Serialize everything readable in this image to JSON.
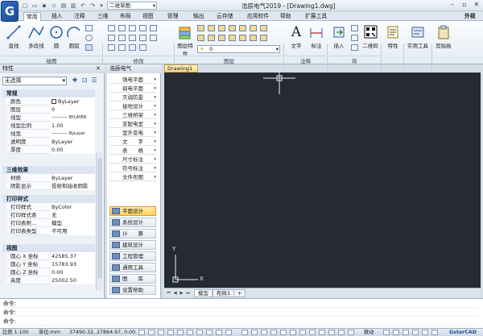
{
  "titlebar": {
    "logo_letter": "G",
    "workspace": "二维草图",
    "title": "浩辰电气2019 - [Drawing1.dwg]",
    "external": "外视"
  },
  "menu": {
    "tabs": [
      "常用",
      "插入",
      "注释",
      "三维",
      "布局",
      "视图",
      "管理",
      "输出",
      "云存储",
      "应用软件",
      "帮助",
      "扩展工具"
    ],
    "active": "常用"
  },
  "ribbon": {
    "tools": {
      "line": "直线",
      "polyline": "多段线",
      "circle": "圆",
      "arc": "圆弧",
      "layer_props": "图层特性",
      "text": "文字",
      "dimension": "标注",
      "insert": "插入",
      "qrcode": "二维码",
      "properties": "特性",
      "utilities": "实用工具",
      "clipboard": "剪贴板"
    },
    "layer_value": "0",
    "groups": [
      "绘图",
      "修改",
      "图层",
      "注释",
      "块"
    ]
  },
  "properties": {
    "title": "特性",
    "selection": "无选择",
    "sections": {
      "general": "常规",
      "effect3d": "三维效果",
      "plot": "打印样式",
      "view": "视图"
    },
    "general": [
      {
        "k": "颜色",
        "v": "ByLayer"
      },
      {
        "k": "图层",
        "v": "0"
      },
      {
        "k": "线型",
        "v": "———— BYLAYER"
      },
      {
        "k": "线型比例",
        "v": "1.00"
      },
      {
        "k": "线宽",
        "v": "———— ByLayer"
      },
      {
        "k": "透明度",
        "v": "ByLayer"
      },
      {
        "k": "厚度",
        "v": "0.00"
      }
    ],
    "effect3d": [
      {
        "k": "材质",
        "v": "ByLayer"
      },
      {
        "k": "阴影显示",
        "v": "投射和接收阴影"
      }
    ],
    "plot": [
      {
        "k": "打印样式",
        "v": "ByColor"
      },
      {
        "k": "打印样式表",
        "v": "无"
      },
      {
        "k": "打印表附...",
        "v": "模型"
      },
      {
        "k": "打印表类型",
        "v": "不可用"
      }
    ],
    "view": [
      {
        "k": "圆心 X 坐标",
        "v": "42585.37"
      },
      {
        "k": "圆心 Y 坐标",
        "v": "15783.93"
      },
      {
        "k": "圆心 Z 坐标",
        "v": "0.00"
      },
      {
        "k": "高度",
        "v": "25002.50"
      }
    ]
  },
  "dq_panel": {
    "title": "浩辰电气",
    "items": [
      "强电平面",
      "弱电平面",
      "灭弱防雷",
      "接地设计",
      "三维桥架",
      "变配电室",
      "室外变电",
      "文　　字",
      "表　　格",
      "尺寸标注",
      "符号标注",
      "文件布图"
    ],
    "buttons": [
      "平面设计",
      "系统设计",
      "计　　算",
      "建筑设计",
      "工程管理",
      "通用工具",
      "图　　库",
      "设置帮助"
    ],
    "active_button": "平面设计"
  },
  "drawing": {
    "tab": "Drawing1",
    "background": "#262b33",
    "axis_y": "Y",
    "axis_x": "X",
    "layout_tabs": [
      "模型",
      "布局1"
    ],
    "active_layout": "模型",
    "add_tab": "+"
  },
  "command": {
    "lines": [
      "命令:",
      "命令:",
      "命令:"
    ]
  },
  "status": {
    "scale": "比例 1:100",
    "units": "单位:mm",
    "coords": "37490.32, 27864.97, 0.00",
    "link": "联动",
    "brand": "GstarCAD"
  }
}
